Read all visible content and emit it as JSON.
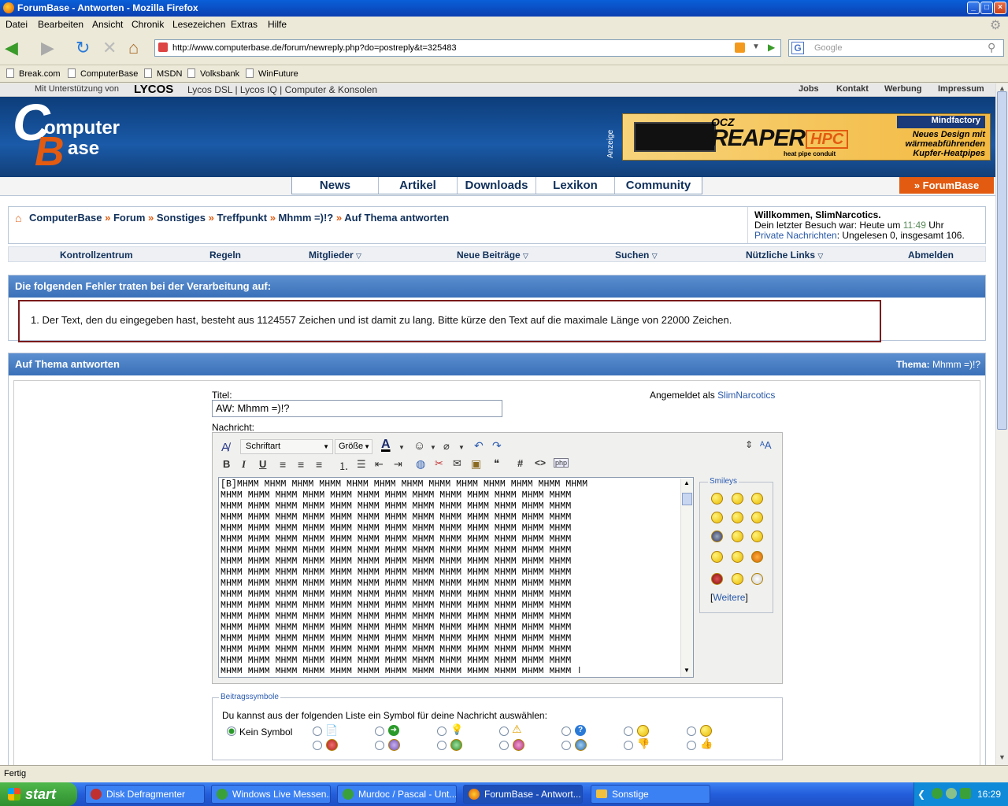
{
  "window": {
    "title": "ForumBase - Antworten - Mozilla Firefox"
  },
  "menu": [
    "Datei",
    "Bearbeiten",
    "Ansicht",
    "Chronik",
    "Lesezeichen",
    "Extras",
    "Hilfe"
  ],
  "url": "http://www.computerbase.de/forum/newreply.php?do=postreply&t=325483",
  "search_placeholder": "Google",
  "bookmarks": [
    "Break.com",
    "ComputerBase",
    "MSDN",
    "Volksbank",
    "WinFuture"
  ],
  "lycos": {
    "prefix": "Mit Unterstützung von",
    "brand": "LYCOS",
    "links": "Lycos DSL | Lycos IQ | Computer & Konsolen"
  },
  "toplinks": [
    "Jobs",
    "Kontakt",
    "Werbung",
    "Impressum"
  ],
  "logo": {
    "line1": "omputer",
    "line2": "ase"
  },
  "ad": {
    "label": "Anzeige",
    "brand": "OCZ",
    "product": "REAPER",
    "hpc": "HPC",
    "sub": "heat pipe conduit",
    "shop": "Mindfactory",
    "text": "Neues Design mit wärmeabführenden Kupfer-Heatpipes"
  },
  "nav": [
    "News",
    "Artikel",
    "Downloads",
    "Lexikon",
    "Community"
  ],
  "forumbase_btn": "» ForumBase",
  "breadcrumb": [
    "ComputerBase",
    "Forum",
    "Sonstiges",
    "Treffpunkt",
    "Mhmm =)!?",
    "Auf Thema antworten"
  ],
  "welcome": {
    "title": "Willkommen, SlimNarcotics.",
    "last_visit": "Dein letzter Besuch war: Heute um",
    "time": "11:49",
    "suffix": "Uhr",
    "pm_link": "Private Nachrichten",
    "pm_text": ": Ungelesen 0, insgesamt 106."
  },
  "subnav": [
    "Kontrollzentrum",
    "Regeln",
    "Mitglieder",
    "Neue Beiträge",
    "Suchen",
    "Nützliche Links",
    "Abmelden"
  ],
  "error": {
    "heading": "Die folgenden Fehler traten bei der Verarbeitung auf:",
    "item": "1.  Der Text, den du eingegeben hast, besteht aus 1124557 Zeichen und ist damit zu lang. Bitte kürze den Text auf die maximale Länge von 22000 Zeichen."
  },
  "reply": {
    "heading": "Auf Thema antworten",
    "thema_label": "Thema:",
    "thema_value": "Mhmm =)!?",
    "title_label": "Titel:",
    "title_value": "AW: Mhmm =)!?",
    "logged_in": "Angemeldet als",
    "user": "SlimNarcotics",
    "message_label": "Nachricht:",
    "font": "Schriftart",
    "size": "Größe"
  },
  "editor_text": "[B]MHMM MHMM MHMM MHMM MHMM MHMM MHMM MHMM MHMM MHMM MHMM MHMM MHMM\nMHMM MHMM MHMM MHMM MHMM MHMM MHMM MHMM MHMM MHMM MHMM MHMM MHMM\nMHMM MHMM MHMM MHMM MHMM MHMM MHMM MHMM MHMM MHMM MHMM MHMM MHMM\nMHMM MHMM MHMM MHMM MHMM MHMM MHMM MHMM MHMM MHMM MHMM MHMM MHMM\nMHMM MHMM MHMM MHMM MHMM MHMM MHMM MHMM MHMM MHMM MHMM MHMM MHMM\nMHMM MHMM MHMM MHMM MHMM MHMM MHMM MHMM MHMM MHMM MHMM MHMM MHMM\nMHMM MHMM MHMM MHMM MHMM MHMM MHMM MHMM MHMM MHMM MHMM MHMM MHMM\nMHMM MHMM MHMM MHMM MHMM MHMM MHMM MHMM MHMM MHMM MHMM MHMM MHMM\nMHMM MHMM MHMM MHMM MHMM MHMM MHMM MHMM MHMM MHMM MHMM MHMM MHMM\nMHMM MHMM MHMM MHMM MHMM MHMM MHMM MHMM MHMM MHMM MHMM MHMM MHMM\nMHMM MHMM MHMM MHMM MHMM MHMM MHMM MHMM MHMM MHMM MHMM MHMM MHMM\nMHMM MHMM MHMM MHMM MHMM MHMM MHMM MHMM MHMM MHMM MHMM MHMM MHMM\nMHMM MHMM MHMM MHMM MHMM MHMM MHMM MHMM MHMM MHMM MHMM MHMM MHMM\nMHMM MHMM MHMM MHMM MHMM MHMM MHMM MHMM MHMM MHMM MHMM MHMM MHMM\nMHMM MHMM MHMM MHMM MHMM MHMM MHMM MHMM MHMM MHMM MHMM MHMM MHMM\nMHMM MHMM MHMM MHMM MHMM MHMM MHMM MHMM MHMM MHMM MHMM MHMM MHMM\nMHMM MHMM MHMM MHMM MHMM MHMM MHMM MHMM MHMM MHMM MHMM MHMM MHMM\nMHMM MHMM MHMM MHMM MHMM MHMM MHMM MHMM MHMM MHMM MHMM MHMM MHMM |\nMHMM MHMM MHMM MHMM MHMM MHMM MHMM MHMM MHMM MHMM MHMM MHMM MHMM",
  "smileys": {
    "title": "Smileys",
    "more": "Weitere"
  },
  "symbols": {
    "legend": "Beitragssymbole",
    "text": "Du kannst aus der folgenden Liste ein Symbol für deine Nachricht auswählen:",
    "none": "Kein Symbol"
  },
  "status": "Fertig",
  "taskbar": {
    "start": "start",
    "tasks": [
      "Disk Defragmenter",
      "Windows Live Messen...",
      "Murdoc / Pascal - Unt...",
      "ForumBase - Antwort...",
      "Sonstige"
    ],
    "clock": "16:29"
  },
  "colors": {
    "accent": "#3a70b8",
    "error_border": "#7a1a1a",
    "orange": "#e25b10"
  }
}
